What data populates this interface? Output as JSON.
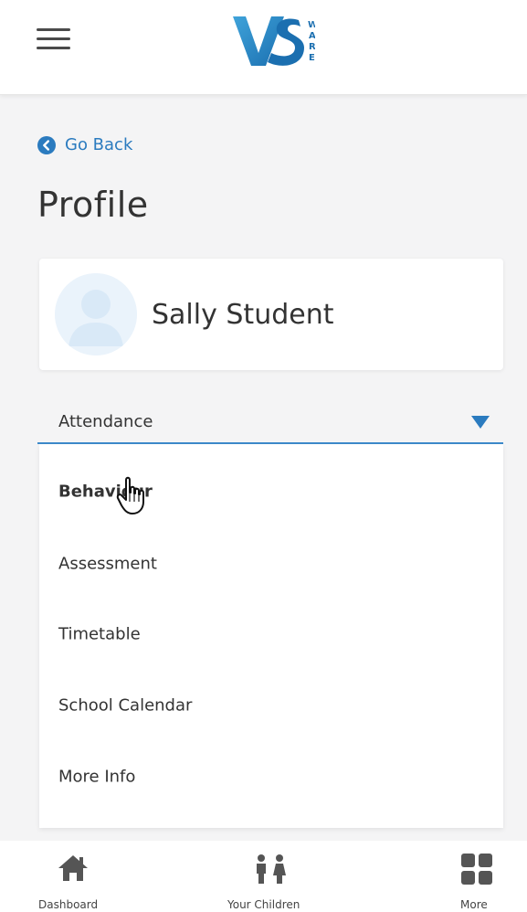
{
  "header": {
    "logo_alt": "VSWARE",
    "logo_letters": "VS",
    "logo_suffix": "WARE",
    "menu_icon": "hamburger-menu-icon"
  },
  "back_link": {
    "label": "Go Back",
    "icon": "chevron-left-circle-icon"
  },
  "page_title": "Profile",
  "profile": {
    "name": "Sally Student",
    "avatar_icon": "user-avatar-icon"
  },
  "section_select": {
    "selected": "Attendance",
    "arrow_icon": "triangle-down-icon"
  },
  "dropdown": {
    "items": [
      {
        "label": "Behaviour"
      },
      {
        "label": "Assessment"
      },
      {
        "label": "Timetable"
      },
      {
        "label": "School Calendar"
      },
      {
        "label": "More Info"
      }
    ]
  },
  "bottom_nav": {
    "items": [
      {
        "label": "Dashboard",
        "icon": "home-icon"
      },
      {
        "label": "Your Children",
        "icon": "children-icon"
      },
      {
        "label": "More",
        "icon": "grid-icon"
      }
    ]
  },
  "colors": {
    "accent": "#2b7bbf",
    "logo_blue": "#1b6fb0",
    "logo_light": "#3fa3da",
    "text": "#333333",
    "background": "#f4f4f5"
  }
}
